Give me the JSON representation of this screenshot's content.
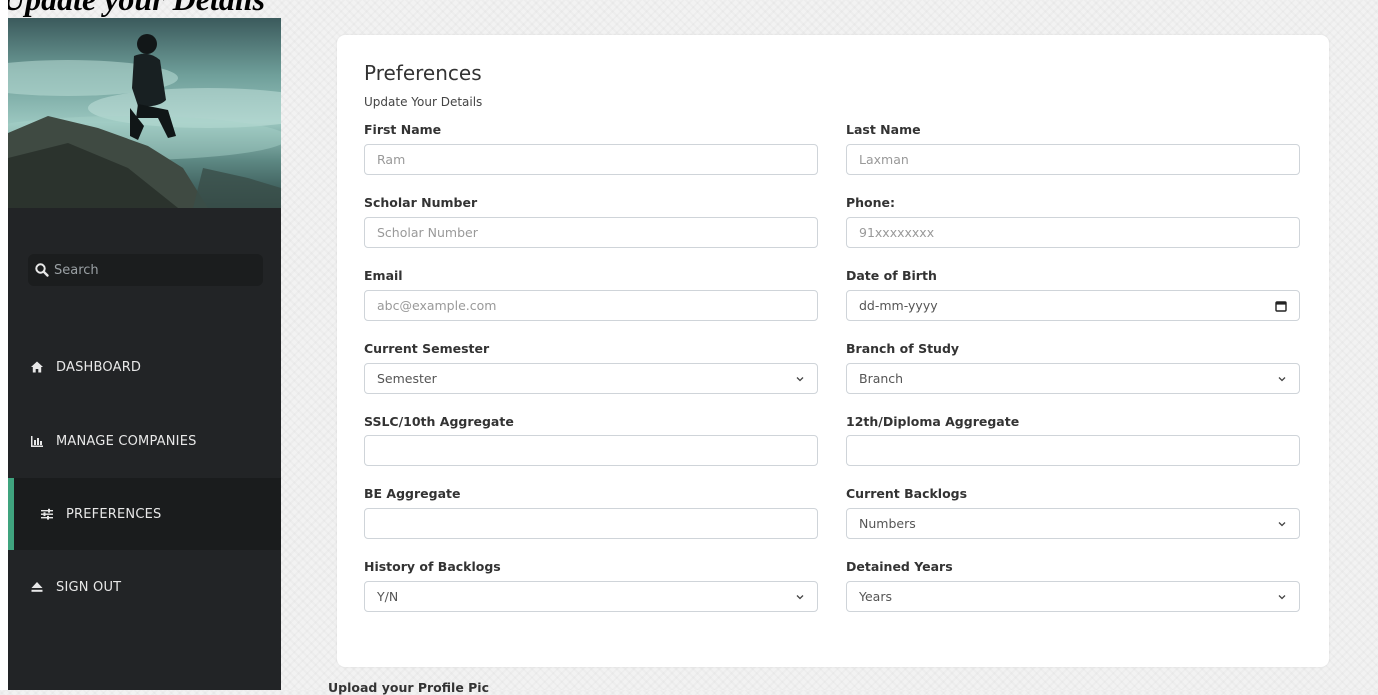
{
  "page": {
    "heading": "Update your Details"
  },
  "sidebar": {
    "search_placeholder": "Search",
    "items": [
      {
        "label": "DASHBOARD",
        "icon": "home-icon"
      },
      {
        "label": "MANAGE COMPANIES",
        "icon": "bar-chart-icon"
      },
      {
        "label": "PREFERENCES",
        "icon": "sliders-icon",
        "active": true
      },
      {
        "label": "SIGN OUT",
        "icon": "eject-icon"
      }
    ],
    "accent_color": "#3fa37e"
  },
  "form": {
    "title": "Preferences",
    "subtitle": "Update Your Details",
    "fields": {
      "first_name": {
        "label": "First Name",
        "placeholder": "Ram"
      },
      "last_name": {
        "label": "Last Name",
        "placeholder": "Laxman"
      },
      "scholar_number": {
        "label": "Scholar Number",
        "placeholder": "Scholar Number"
      },
      "phone": {
        "label": "Phone:",
        "placeholder": "91xxxxxxxx"
      },
      "email": {
        "label": "Email",
        "placeholder": "abc@example.com"
      },
      "dob": {
        "label": "Date of Birth",
        "value": "dd-mm-yyyy"
      },
      "semester": {
        "label": "Current Semester",
        "value": "Semester"
      },
      "branch": {
        "label": "Branch of Study",
        "value": "Branch"
      },
      "sslc": {
        "label": "SSLC/10th Aggregate",
        "value": ""
      },
      "diploma": {
        "label": "12th/Diploma Aggregate",
        "value": ""
      },
      "be": {
        "label": "BE Aggregate",
        "value": ""
      },
      "backlogs": {
        "label": "Current Backlogs",
        "value": "Numbers"
      },
      "history": {
        "label": "History of Backlogs",
        "value": "Y/N"
      },
      "detained": {
        "label": "Detained Years",
        "value": "Years"
      }
    },
    "upload_label": "Upload your Profile Pic"
  }
}
